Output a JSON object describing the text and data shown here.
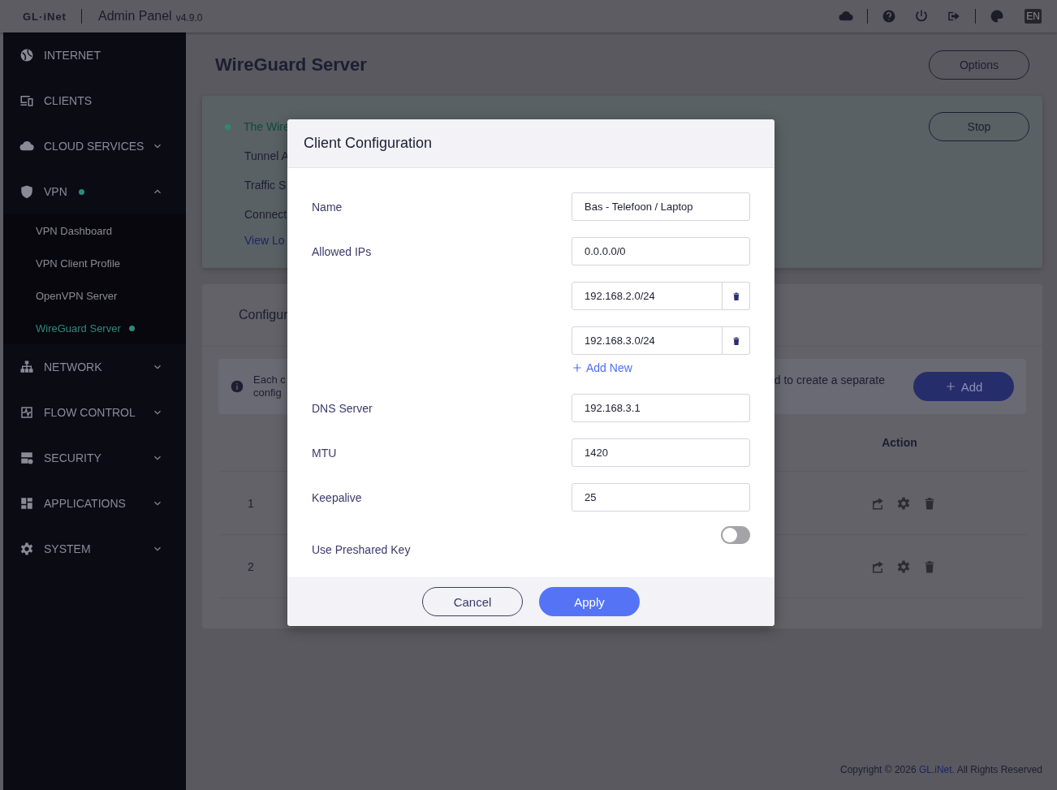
{
  "header": {
    "logo": "GL·iNet",
    "title": "Admin Panel",
    "version": "v4.9.0",
    "language": "EN"
  },
  "sidebar": {
    "items": [
      {
        "label": "INTERNET"
      },
      {
        "label": "CLIENTS"
      },
      {
        "label": "CLOUD SERVICES",
        "expanded": false
      },
      {
        "label": "VPN",
        "expanded": true,
        "status_dot": true,
        "children": [
          {
            "label": "VPN Dashboard",
            "selected": false,
            "status_dot": false
          },
          {
            "label": "VPN Client Profile",
            "selected": false,
            "status_dot": false
          },
          {
            "label": "OpenVPN Server",
            "selected": false,
            "status_dot": false
          },
          {
            "label": "WireGuard Server",
            "selected": true,
            "status_dot": true
          }
        ]
      },
      {
        "label": "NETWORK",
        "expanded": false
      },
      {
        "label": "FLOW CONTROL",
        "expanded": false
      },
      {
        "label": "SECURITY",
        "expanded": false
      },
      {
        "label": "APPLICATIONS",
        "expanded": false
      },
      {
        "label": "SYSTEM",
        "expanded": false
      }
    ]
  },
  "main": {
    "title": "WireGuard Server",
    "options_button": "Options",
    "status_card": {
      "on": true,
      "status_text": "The Wire",
      "rows": [
        "Tunnel A",
        "Traffic S",
        "Connect"
      ],
      "link": "View Lo",
      "stop_button": "Stop"
    },
    "config_card": {
      "title": "Configur",
      "info_lines": [
        "Each c",
        "config"
      ],
      "info_right": "d to create a separate",
      "add_button": "Add",
      "table": {
        "columns": [
          "Action"
        ],
        "rows": [
          {
            "column_1": "1"
          },
          {
            "column_1": "2"
          }
        ]
      }
    }
  },
  "modal": {
    "title": "Client Configuration",
    "fields": [
      {
        "kind": "text",
        "label": "Name",
        "value": "Bas - Telefoon / Laptop"
      },
      {
        "kind": "text",
        "label": "Allowed IPs",
        "value": "0.0.0.0/0"
      },
      {
        "kind": "removable",
        "value": "192.168.2.0/24"
      },
      {
        "kind": "removable",
        "value": "192.168.3.0/24"
      },
      {
        "kind": "add_link",
        "label": "Add New"
      },
      {
        "kind": "text",
        "label": "DNS Server",
        "value": "192.168.3.1"
      },
      {
        "kind": "text",
        "label": "MTU",
        "value": "1420"
      },
      {
        "kind": "text",
        "label": "Keepalive",
        "value": "25"
      },
      {
        "kind": "toggle",
        "label": "Use Preshared Key",
        "on": false
      }
    ],
    "buttons": [
      {
        "kind": "secondary",
        "label": "Cancel"
      },
      {
        "kind": "primary",
        "label": "Apply"
      }
    ]
  },
  "footer": {
    "text_before": "Copyright © 2026",
    "link": "GL.iNet.",
    "text_after": "All Rights Reserved"
  }
}
